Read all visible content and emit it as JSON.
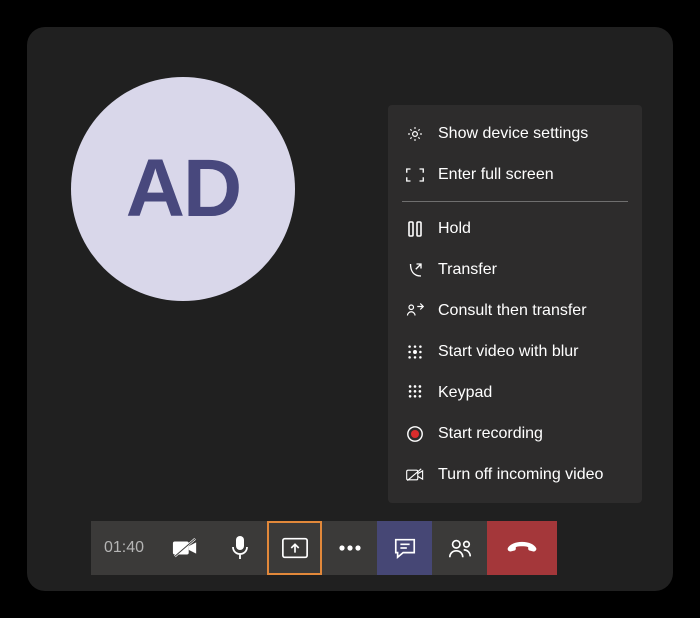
{
  "avatar": {
    "initials": "AD"
  },
  "menu": {
    "showDeviceSettings": "Show device settings",
    "enterFullScreen": "Enter full screen",
    "hold": "Hold",
    "transfer": "Transfer",
    "consultThenTransfer": "Consult then transfer",
    "startVideoWithBlur": "Start video with blur",
    "keypad": "Keypad",
    "startRecording": "Start recording",
    "turnOffIncomingVideo": "Turn off incoming video"
  },
  "toolbar": {
    "timer": "01:40"
  },
  "colors": {
    "avatarBg": "#d9d7ea",
    "avatarFg": "#48487d",
    "accentShare": "#e2883a",
    "chatBg": "#464775",
    "hangupBg": "#a4373a",
    "recordRed": "#d92c2c"
  }
}
